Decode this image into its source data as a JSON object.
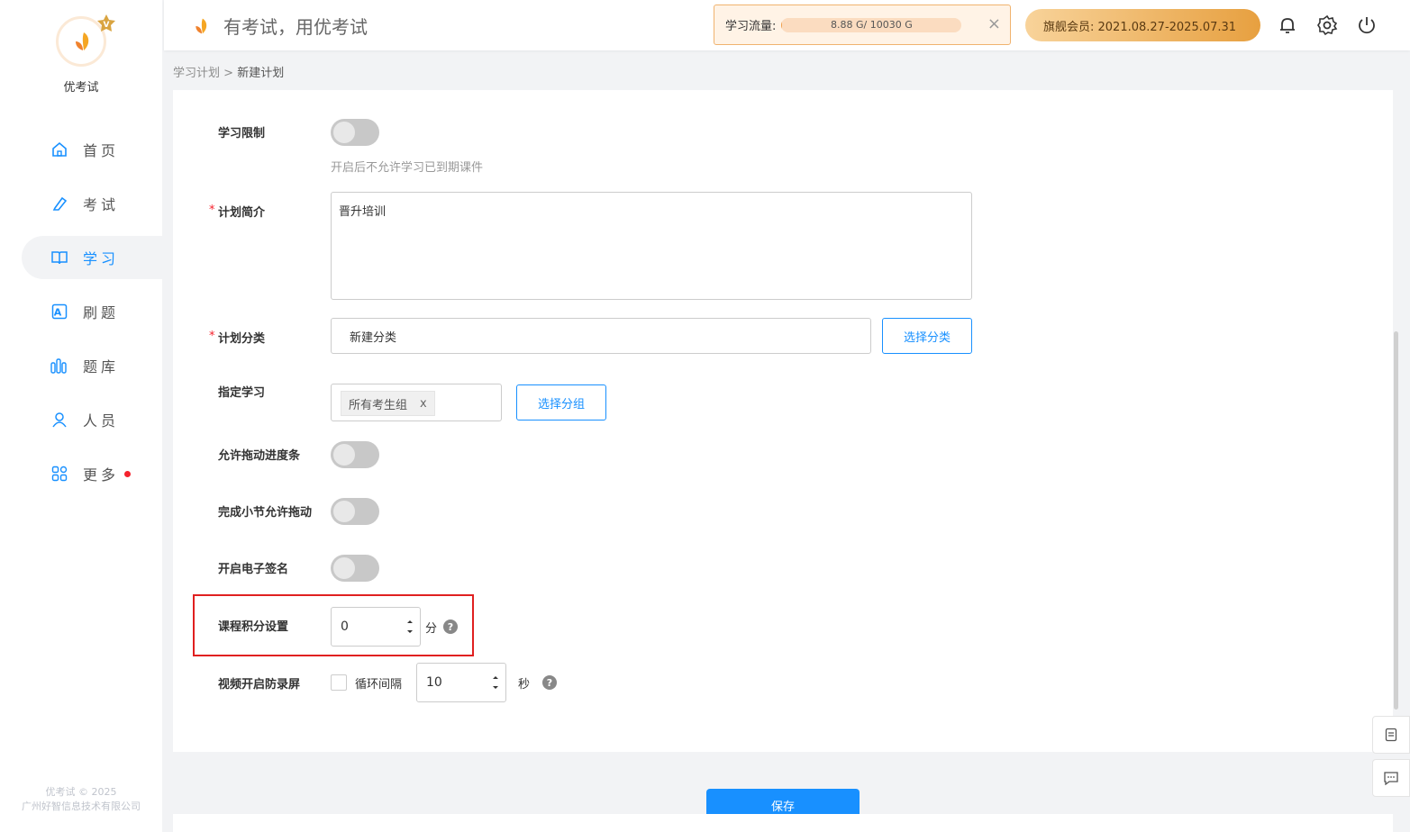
{
  "app": {
    "name": "优考试",
    "slogan": "有考试，用优考试"
  },
  "sidebar": {
    "items": [
      {
        "label": "首页",
        "icon": "home-icon"
      },
      {
        "label": "考试",
        "icon": "exam-icon"
      },
      {
        "label": "学习",
        "icon": "book-icon",
        "active": true
      },
      {
        "label": "刷题",
        "icon": "practice-icon"
      },
      {
        "label": "题库",
        "icon": "question-bank-icon"
      },
      {
        "label": "人员",
        "icon": "user-icon"
      },
      {
        "label": "更多",
        "icon": "more-apps-icon",
        "badge": true
      }
    ],
    "footer_line1": "优考试 © 2025",
    "footer_line2": "广州好智信息技术有限公司"
  },
  "header": {
    "flow_label": "学习流量:",
    "flow_value": "8.88 G/ 10030 G",
    "flow_fraction": 0.0009,
    "close": "×",
    "vip_text": "旗舰会员: 2021.08.27-2025.07.31"
  },
  "breadcrumb": {
    "parent": "学习计划",
    "sep": ">",
    "current": "新建计划"
  },
  "form": {
    "study_limit": {
      "label": "学习限制",
      "hint": "开启后不允许学习已到期课件",
      "on": false
    },
    "intro": {
      "label": "计划简介",
      "value": "晋升培训",
      "required": "*"
    },
    "category": {
      "label": "计划分类",
      "value": "新建分类",
      "button": "选择分类",
      "required": "*"
    },
    "assign": {
      "label": "指定学习",
      "tag": "所有考生组",
      "tag_close": "x",
      "button": "选择分组"
    },
    "allow_drag": {
      "label": "允许拖动进度条",
      "on": false
    },
    "section_drag": {
      "label": "完成小节允许拖动",
      "on": false
    },
    "e_sign": {
      "label": "开启电子签名",
      "on": false
    },
    "points": {
      "label": "课程积分设置",
      "value": "0",
      "unit": "分",
      "help": "?"
    },
    "anti_record": {
      "label": "视频开启防录屏",
      "loop_label": "循环间隔",
      "interval": "10",
      "unit": "秒",
      "help": "?",
      "checked": false
    }
  },
  "actions": {
    "save": "保存"
  },
  "colors": {
    "primary": "#1890ff",
    "accent": "#f0a04b",
    "highlight": "#e02020"
  }
}
